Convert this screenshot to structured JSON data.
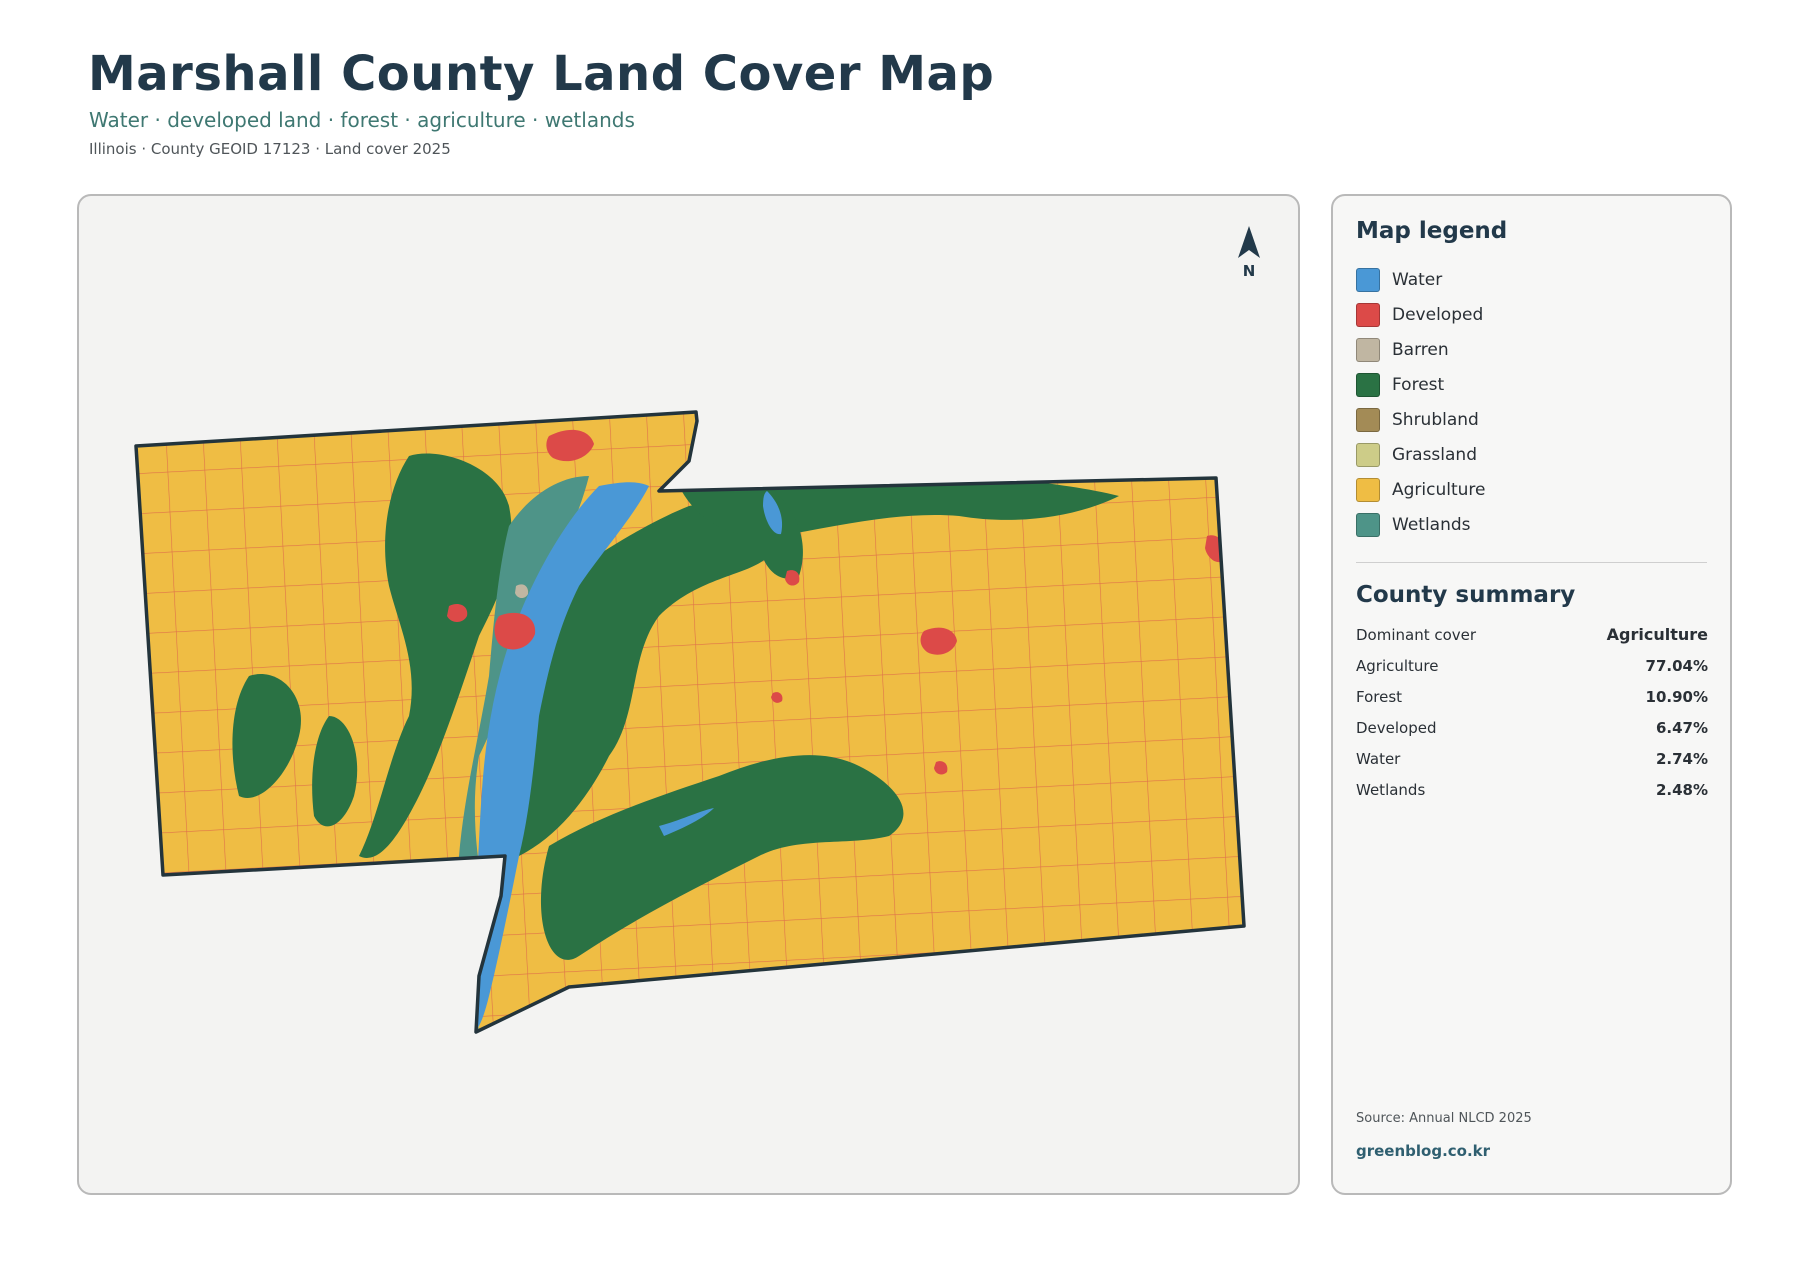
{
  "header": {
    "title": "Marshall County Land Cover Map",
    "subtitle": "Water · developed land · forest · agriculture · wetlands",
    "meta": "Illinois · County GEOID 17123 · Land cover 2025"
  },
  "map": {
    "north_label": "N"
  },
  "legend": {
    "heading": "Map legend",
    "items": [
      {
        "label": "Water",
        "color": "#4a98d6"
      },
      {
        "label": "Developed",
        "color": "#dc4a48"
      },
      {
        "label": "Barren",
        "color": "#c0b6a2"
      },
      {
        "label": "Forest",
        "color": "#2a7244"
      },
      {
        "label": "Shrubland",
        "color": "#a38b56"
      },
      {
        "label": "Grassland",
        "color": "#cdcc88"
      },
      {
        "label": "Agriculture",
        "color": "#efbd44"
      },
      {
        "label": "Wetlands",
        "color": "#4e9488"
      }
    ]
  },
  "summary": {
    "heading": "County summary",
    "rows": [
      {
        "label": "Dominant cover",
        "value": "Agriculture"
      },
      {
        "label": "Agriculture",
        "value": "77.04%"
      },
      {
        "label": "Forest",
        "value": "10.90%"
      },
      {
        "label": "Developed",
        "value": "6.47%"
      },
      {
        "label": "Water",
        "value": "2.74%"
      },
      {
        "label": "Wetlands",
        "value": "2.48%"
      }
    ]
  },
  "footer": {
    "source": "Source: Annual NLCD 2025",
    "site": "greenblog.co.kr"
  }
}
